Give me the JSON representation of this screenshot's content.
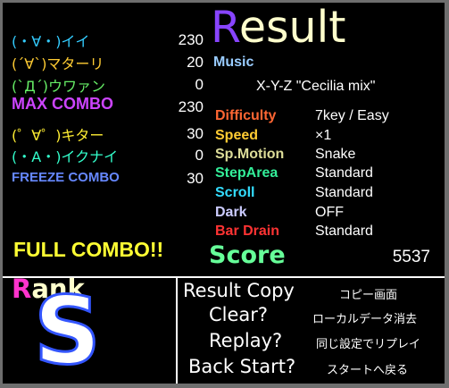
{
  "judges": [
    {
      "label": "(・∀・)イイ",
      "value": "230",
      "color": "#33ccff"
    },
    {
      "label": "(´∀`)マターリ",
      "value": "20",
      "color": "#ffcc33"
    },
    {
      "label": "(`Д´)ウワァン",
      "value": "0",
      "color": "#66ee66"
    },
    {
      "label": "MAX COMBO",
      "value": "230",
      "color": "#cc44ff"
    },
    {
      "label": "(゜∀゜)キター",
      "value": "30",
      "color": "#ffee33"
    },
    {
      "label": "(・A・)イクナイ",
      "value": "0",
      "color": "#33ffcc"
    },
    {
      "label": "FREEZE COMBO",
      "value": "30",
      "color": "#6688ff"
    }
  ],
  "full_combo": "FULL COMBO!!",
  "title": {
    "first": "R",
    "rest": "esult",
    "first_color": "#8844ff",
    "rest_color": "#ffffcc"
  },
  "music": {
    "label": "Music",
    "value": "X-Y-Z \"Cecilia mix\"",
    "label_color": "#99ccff"
  },
  "settings": [
    {
      "label": "Difficulty",
      "value": "7key / Easy",
      "color": "#ff6633"
    },
    {
      "label": "Speed",
      "value": "×1",
      "color": "#ffcc33"
    },
    {
      "label": "Sp.Motion",
      "value": "Snake",
      "color": "#dddd99"
    },
    {
      "label": "StepArea",
      "value": "Standard",
      "color": "#33ee99"
    },
    {
      "label": "Scroll",
      "value": "Standard",
      "color": "#33ddff"
    },
    {
      "label": "Dark",
      "value": "OFF",
      "color": "#ccccff"
    },
    {
      "label": "Bar Drain",
      "value": "Standard",
      "color": "#ff3333"
    }
  ],
  "score": {
    "label": "Score",
    "value": "5537",
    "color": "#66ff99"
  },
  "rank": {
    "first": "R",
    "rest": "ank",
    "grade": "S",
    "first_color": "#ff33cc"
  },
  "menu": [
    {
      "label": "Result Copy",
      "sub": "コピー画面"
    },
    {
      "label": "Clear?",
      "sub": "ローカルデータ消去"
    },
    {
      "label": "Replay?",
      "sub": "同じ設定でリプレイ"
    },
    {
      "label": "Back Start?",
      "sub": "スタートへ戻る"
    }
  ]
}
